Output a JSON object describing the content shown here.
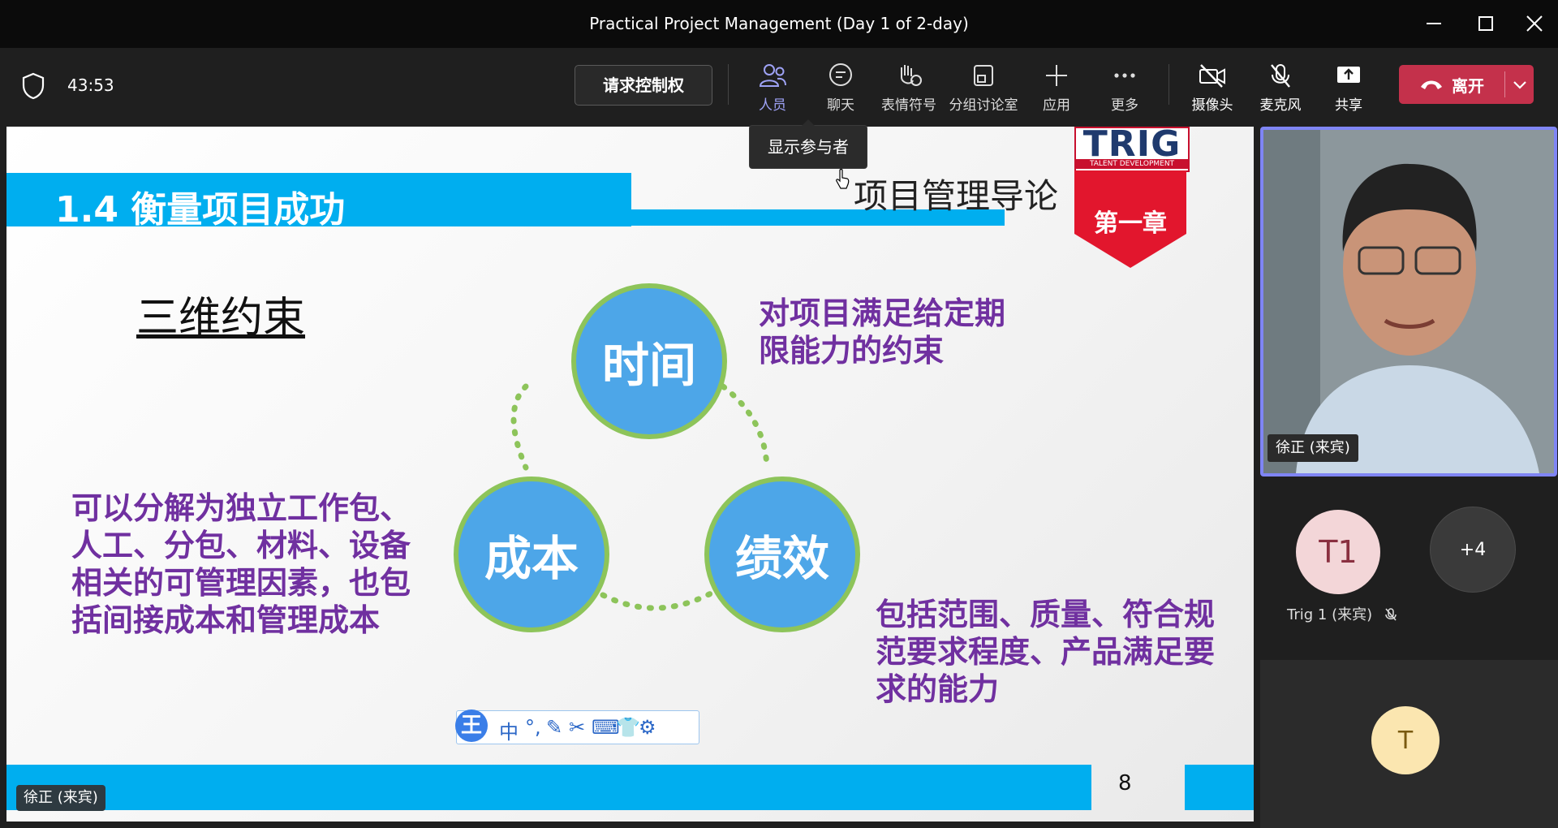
{
  "window": {
    "title": "Practical Project Management (Day 1 of 2-day)"
  },
  "toolbar": {
    "timer": "43:53",
    "request_control": "请求控制权",
    "people": "人员",
    "chat": "聊天",
    "reactions": "表情符号",
    "breakout": "分组讨论室",
    "apps": "应用",
    "more": "更多",
    "camera": "摄像头",
    "mic": "麦克风",
    "share": "共享",
    "leave": "离开"
  },
  "tooltip": {
    "text": "显示参与者"
  },
  "slide": {
    "title": "1.4 衡量项目成功",
    "chapter_intro": "项目管理导论",
    "logo": "TRIG",
    "logo_sub": "TALENT DEVELOPMENT",
    "chapter_badge": "第一章",
    "subtitle": "三维约束",
    "time": "时间",
    "cost": "成本",
    "performance": "绩效",
    "time_desc_1": "对项目满足给定期",
    "time_desc_2": "限能力的约束",
    "cost_desc_1": "可以分解为独立工作包、",
    "cost_desc_2": "人工、分包、材料、设备",
    "cost_desc_3": "相关的可管理因素，也包",
    "cost_desc_4": "括间接成本和管理成本",
    "perf_desc_1": "包括范围、质量、符合规",
    "perf_desc_2": "范要求程度、产品满足要",
    "perf_desc_3": "求的能力",
    "page_number": "8"
  },
  "ime": {
    "logo": "王",
    "lang": "中"
  },
  "presenter": {
    "name": "徐正 (来宾)"
  },
  "participants": {
    "video_name": "徐正 (来宾)",
    "t1_initials": "T1",
    "t1_name": "Trig 1 (来宾)",
    "more_count": "+4",
    "t_initials": "T"
  },
  "colors": {
    "accent": "#7f85f5",
    "leave": "#c4314b",
    "slide_blue": "#00aeef",
    "purple": "#7030a0",
    "green": "#8dc45a"
  }
}
